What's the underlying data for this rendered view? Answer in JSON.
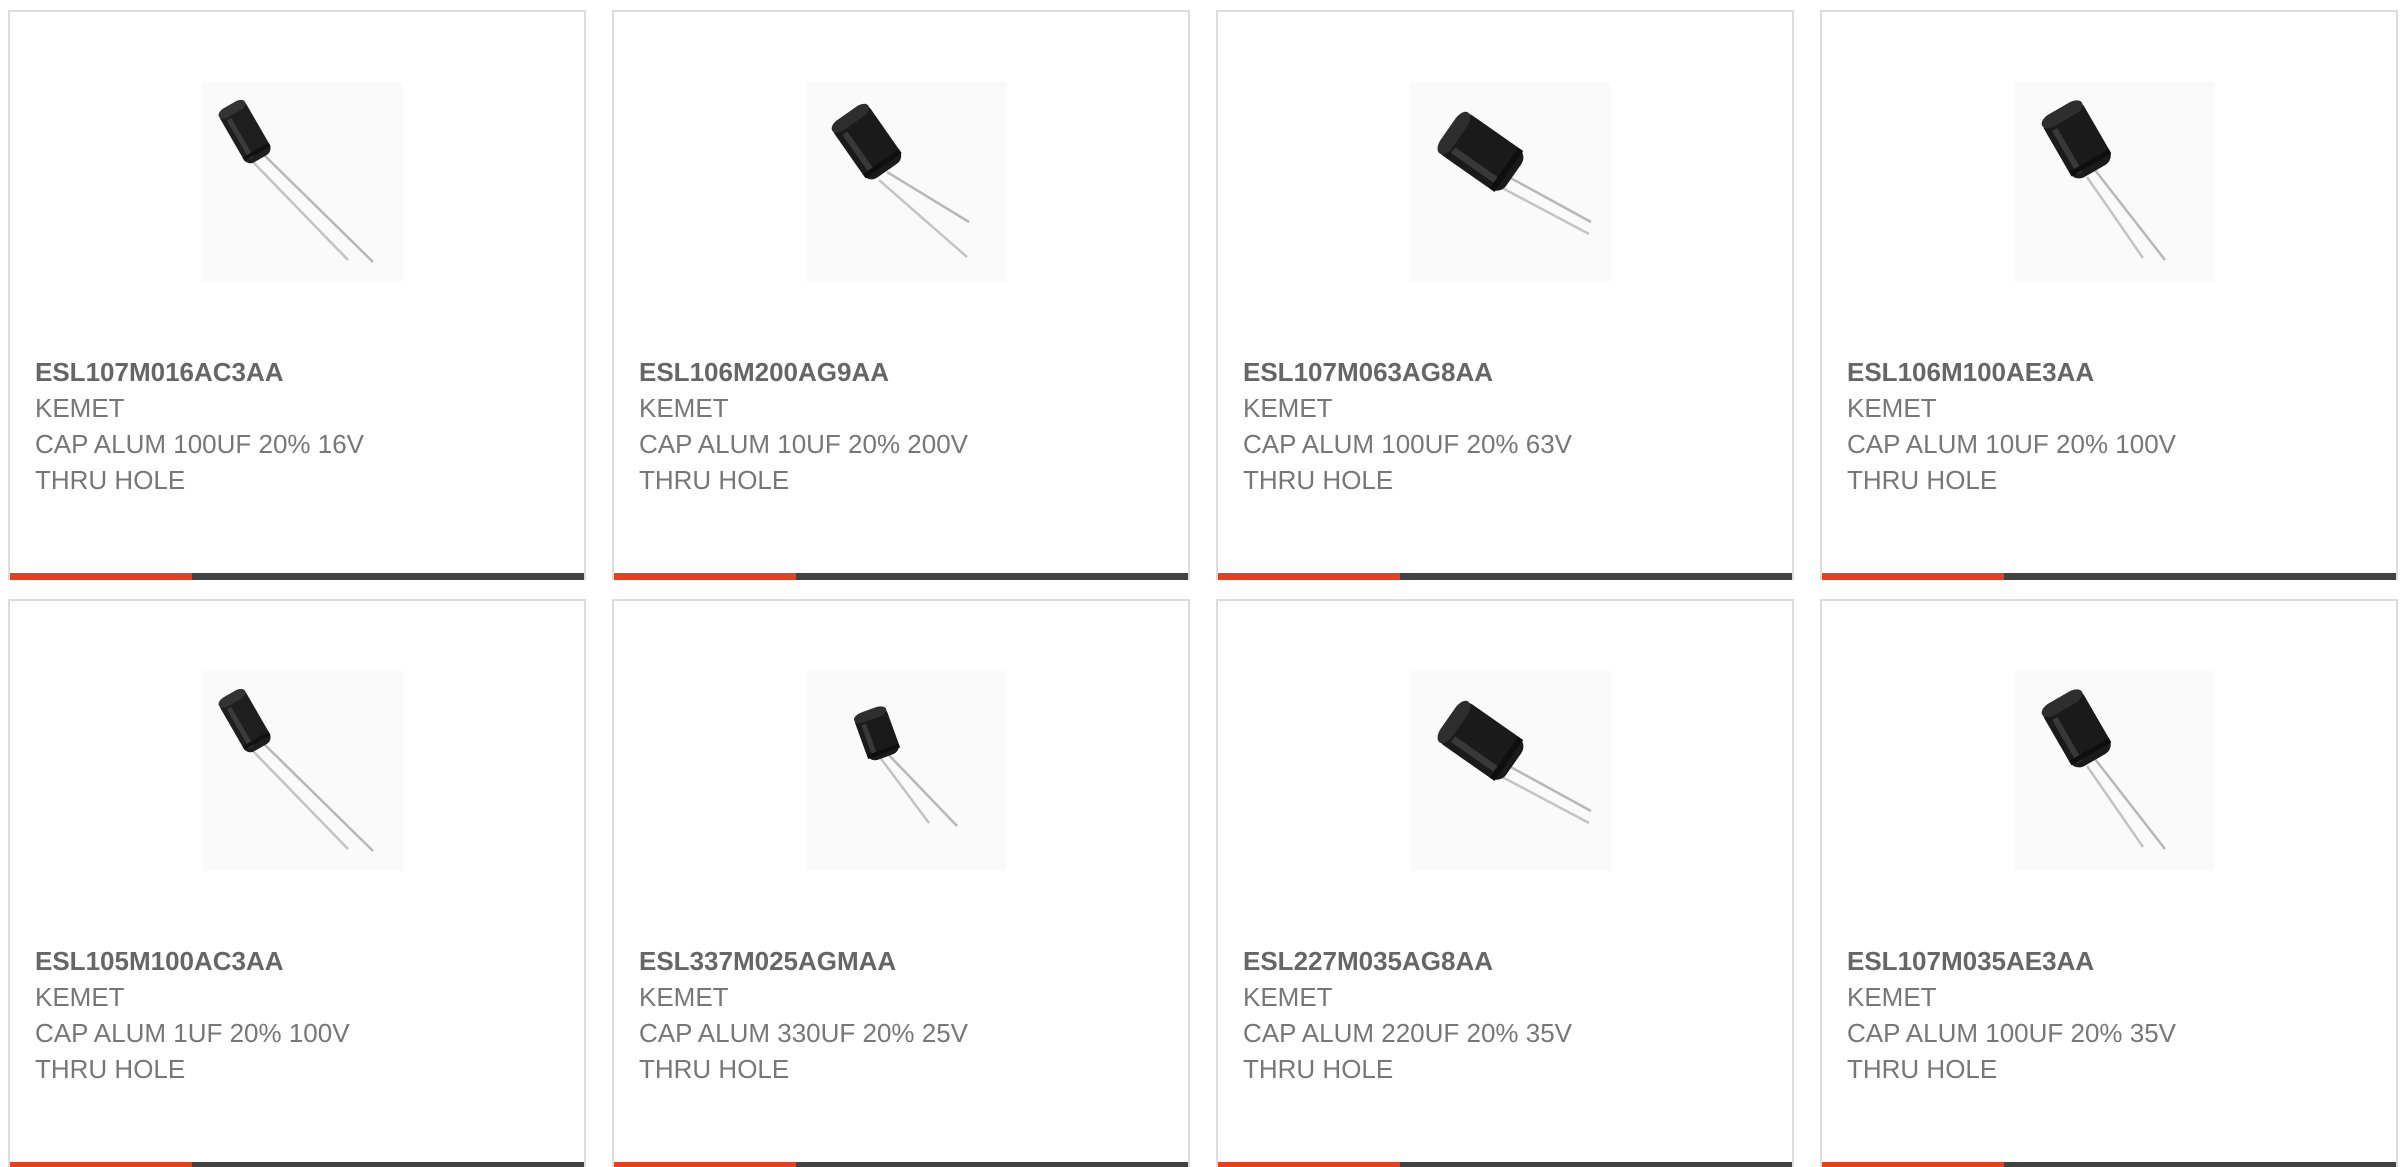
{
  "colors": {
    "accent": "#e8401c",
    "bar_dark": "#424242",
    "border": "#dddddd",
    "text": "#666666"
  },
  "products": [
    {
      "part_number": "ESL107M016AC3AA",
      "manufacturer": "KEMET",
      "desc_line1": "CAP ALUM 100UF 20% 16V",
      "desc_line2": "THRU HOLE",
      "image_icon": "capacitor-small-icon"
    },
    {
      "part_number": "ESL106M200AG9AA",
      "manufacturer": "KEMET",
      "desc_line1": "CAP ALUM 10UF 20% 200V",
      "desc_line2": "THRU HOLE",
      "image_icon": "capacitor-medium-icon"
    },
    {
      "part_number": "ESL107M063AG8AA",
      "manufacturer": "KEMET",
      "desc_line1": "CAP ALUM 100UF 20% 63V",
      "desc_line2": "THRU HOLE",
      "image_icon": "capacitor-large-icon"
    },
    {
      "part_number": "ESL106M100AE3AA",
      "manufacturer": "KEMET",
      "desc_line1": "CAP ALUM 10UF 20% 100V",
      "desc_line2": "THRU HOLE",
      "image_icon": "capacitor-medium-icon"
    },
    {
      "part_number": "ESL105M100AC3AA",
      "manufacturer": "KEMET",
      "desc_line1": "CAP ALUM 1UF 20% 100V",
      "desc_line2": "THRU HOLE",
      "image_icon": "capacitor-small-icon"
    },
    {
      "part_number": "ESL337M025AGMAA",
      "manufacturer": "KEMET",
      "desc_line1": "CAP ALUM 330UF 20% 25V",
      "desc_line2": "THRU HOLE",
      "image_icon": "capacitor-tiny-icon"
    },
    {
      "part_number": "ESL227M035AG8AA",
      "manufacturer": "KEMET",
      "desc_line1": "CAP ALUM 220UF 20% 35V",
      "desc_line2": "THRU HOLE",
      "image_icon": "capacitor-large-icon"
    },
    {
      "part_number": "ESL107M035AE3AA",
      "manufacturer": "KEMET",
      "desc_line1": "CAP ALUM 100UF 20% 35V",
      "desc_line2": "THRU HOLE",
      "image_icon": "capacitor-medium-icon"
    }
  ]
}
